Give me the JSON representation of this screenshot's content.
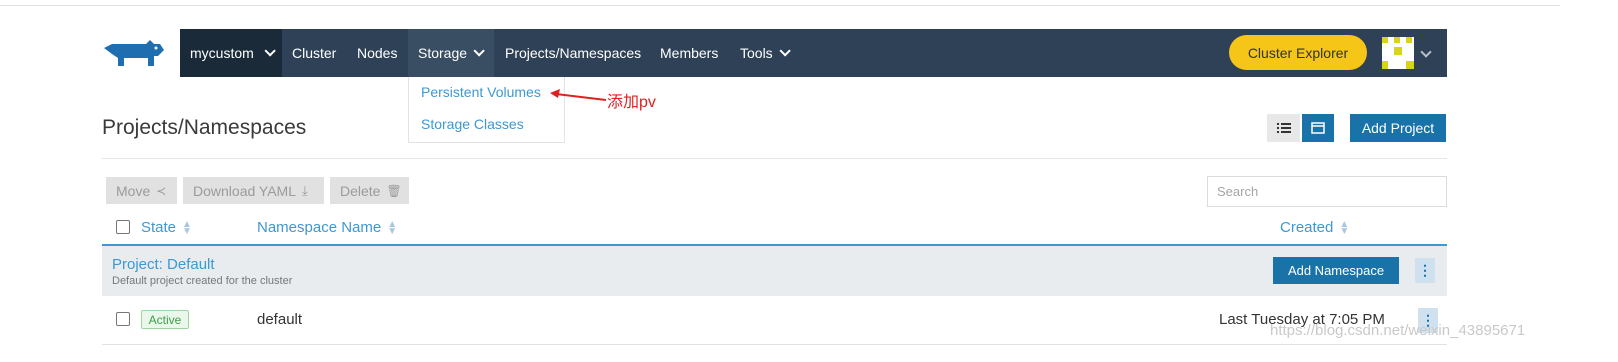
{
  "navbar": {
    "cluster": "mycustom",
    "items": [
      "Cluster",
      "Nodes",
      "Storage",
      "Projects/Namespaces",
      "Members",
      "Tools"
    ],
    "cluster_explorer": "Cluster Explorer",
    "icons": [
      "cow-logo-icon",
      "chevron-down-icon",
      "avatar-icon"
    ],
    "colors": {
      "bar": "#2e4156",
      "explorer": "#f5c518"
    }
  },
  "storage_menu": {
    "items": [
      "Persistent Volumes",
      "Storage Classes"
    ]
  },
  "annotation": "添加pv",
  "page": {
    "title": "Projects/Namespaces",
    "add_project": "Add Project"
  },
  "toolbar": {
    "move": "Move",
    "download_yaml": "Download YAML",
    "delete": "Delete",
    "search_placeholder": "Search"
  },
  "table": {
    "headers": [
      "State",
      "Namespace Name",
      "Created"
    ],
    "group": {
      "title": "Project: Default",
      "description": "Default project created for the cluster",
      "add_namespace": "Add Namespace"
    },
    "rows": [
      {
        "state": "Active",
        "name": "default",
        "created": "Last Tuesday at 7:05 PM"
      }
    ]
  },
  "watermark": "https://blog.csdn.net/weixin_43895671"
}
